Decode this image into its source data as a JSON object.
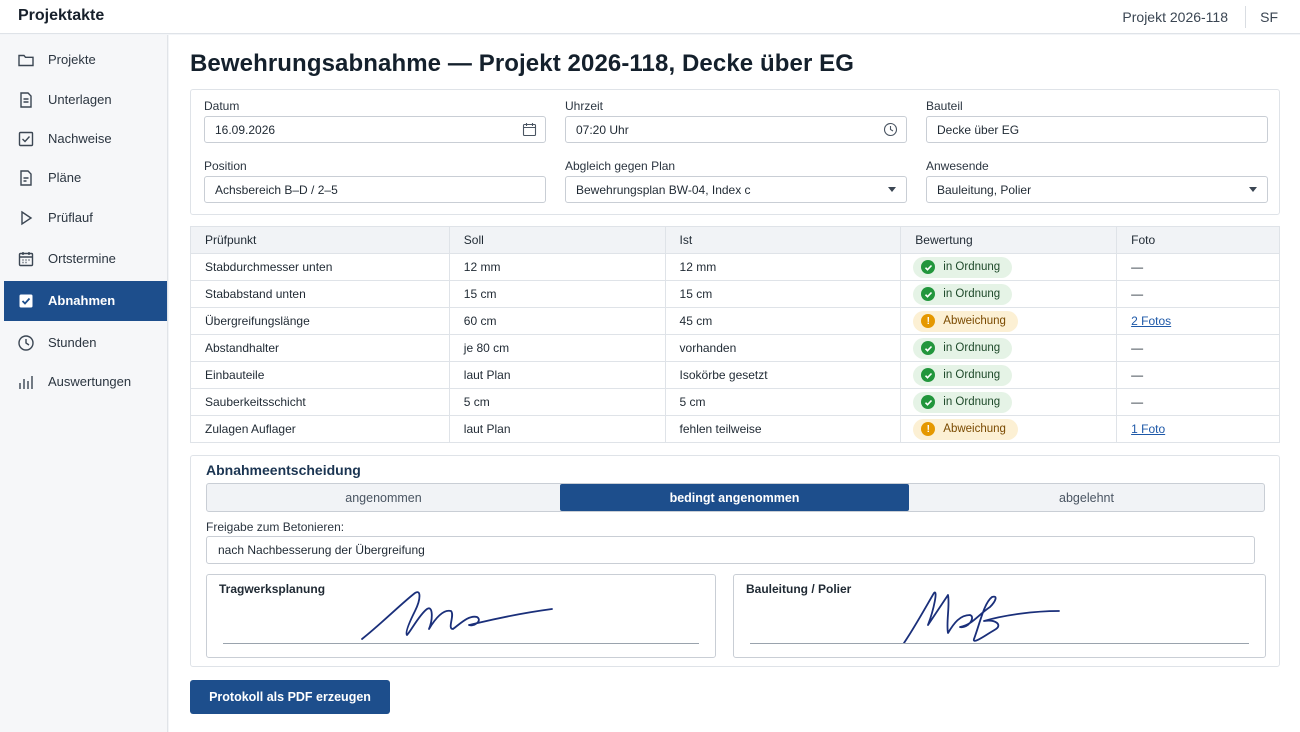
{
  "header": {
    "app_title": "Projektakte",
    "project": "Projekt 2026-118",
    "user_initials": "SF"
  },
  "sidebar": {
    "items": [
      {
        "label": "Projekte",
        "icon": "folder-icon"
      },
      {
        "label": "Unterlagen",
        "icon": "document-icon"
      },
      {
        "label": "Nachweise",
        "icon": "checkbox-icon"
      },
      {
        "label": "Pläne",
        "icon": "plan-icon"
      },
      {
        "label": "Prüflauf",
        "icon": "play-icon"
      },
      {
        "label": "Ortstermine",
        "icon": "calendar-icon"
      },
      {
        "label": "Abnahmen",
        "icon": "check-square-icon",
        "active": true
      },
      {
        "label": "Stunden",
        "icon": "clock-icon"
      },
      {
        "label": "Auswertungen",
        "icon": "bar-chart-icon"
      }
    ]
  },
  "page": {
    "title": "Bewehrungsabnahme — Projekt 2026-118, Decke über EG"
  },
  "form": {
    "datum": {
      "label": "Datum",
      "value": "16.09.2026"
    },
    "uhrzeit": {
      "label": "Uhrzeit",
      "value": "07:20 Uhr"
    },
    "bauteil": {
      "label": "Bauteil",
      "value": "Decke über EG"
    },
    "position": {
      "label": "Position",
      "value": "Achsbereich B–D / 2–5"
    },
    "abgleich": {
      "label": "Abgleich gegen Plan",
      "value": "Bewehrungsplan BW-04, Index c"
    },
    "anwesende": {
      "label": "Anwesende",
      "value": "Bauleitung, Polier"
    }
  },
  "table": {
    "headers": {
      "pruefpunkt": "Prüfpunkt",
      "soll": "Soll",
      "ist": "Ist",
      "bewertung": "Bewertung",
      "foto": "Foto"
    },
    "rows": [
      {
        "pruefpunkt": "Stabdurchmesser unten",
        "soll": "12 mm",
        "ist": "12 mm",
        "bewertung": "in Ordnung",
        "status": "ok",
        "foto": "—",
        "foto_link": false
      },
      {
        "pruefpunkt": "Stababstand unten",
        "soll": "15 cm",
        "ist": "15 cm",
        "bewertung": "in Ordnung",
        "status": "ok",
        "foto": "—",
        "foto_link": false
      },
      {
        "pruefpunkt": "Übergreifungslänge",
        "soll": "60 cm",
        "ist": "45 cm",
        "bewertung": "Abweichung",
        "status": "warn",
        "foto": "2 Fotos",
        "foto_link": true
      },
      {
        "pruefpunkt": "Abstandhalter",
        "soll": "je 80 cm",
        "ist": "vorhanden",
        "bewertung": "in Ordnung",
        "status": "ok",
        "foto": "—",
        "foto_link": false
      },
      {
        "pruefpunkt": "Einbauteile",
        "soll": "laut Plan",
        "ist": "Isokörbe gesetzt",
        "bewertung": "in Ordnung",
        "status": "ok",
        "foto": "—",
        "foto_link": false
      },
      {
        "pruefpunkt": "Sauberkeitsschicht",
        "soll": "5 cm",
        "ist": "5 cm",
        "bewertung": "in Ordnung",
        "status": "ok",
        "foto": "—",
        "foto_link": false
      },
      {
        "pruefpunkt": "Zulagen Auflager",
        "soll": "laut Plan",
        "ist": "fehlen teilweise",
        "bewertung": "Abweichung",
        "status": "warn",
        "foto": "1 Foto",
        "foto_link": true
      }
    ]
  },
  "decision": {
    "title": "Abnahmeentscheidung",
    "options": [
      "angenommen",
      "bedingt angenommen",
      "abgelehnt"
    ],
    "selected": "bedingt angenommen",
    "release_label": "Freigabe zum Betonieren:",
    "release_value": "nach Nachbesserung der Übergreifung",
    "signatures": [
      {
        "label": "Tragwerksplanung"
      },
      {
        "label": "Bauleitung / Polier"
      }
    ]
  },
  "actions": {
    "pdf_label": "Protokoll als PDF erzeugen"
  },
  "colors": {
    "accent": "#1d4e8c",
    "ok": "#22963c",
    "warn": "#e59800",
    "link": "#1d58a8"
  }
}
